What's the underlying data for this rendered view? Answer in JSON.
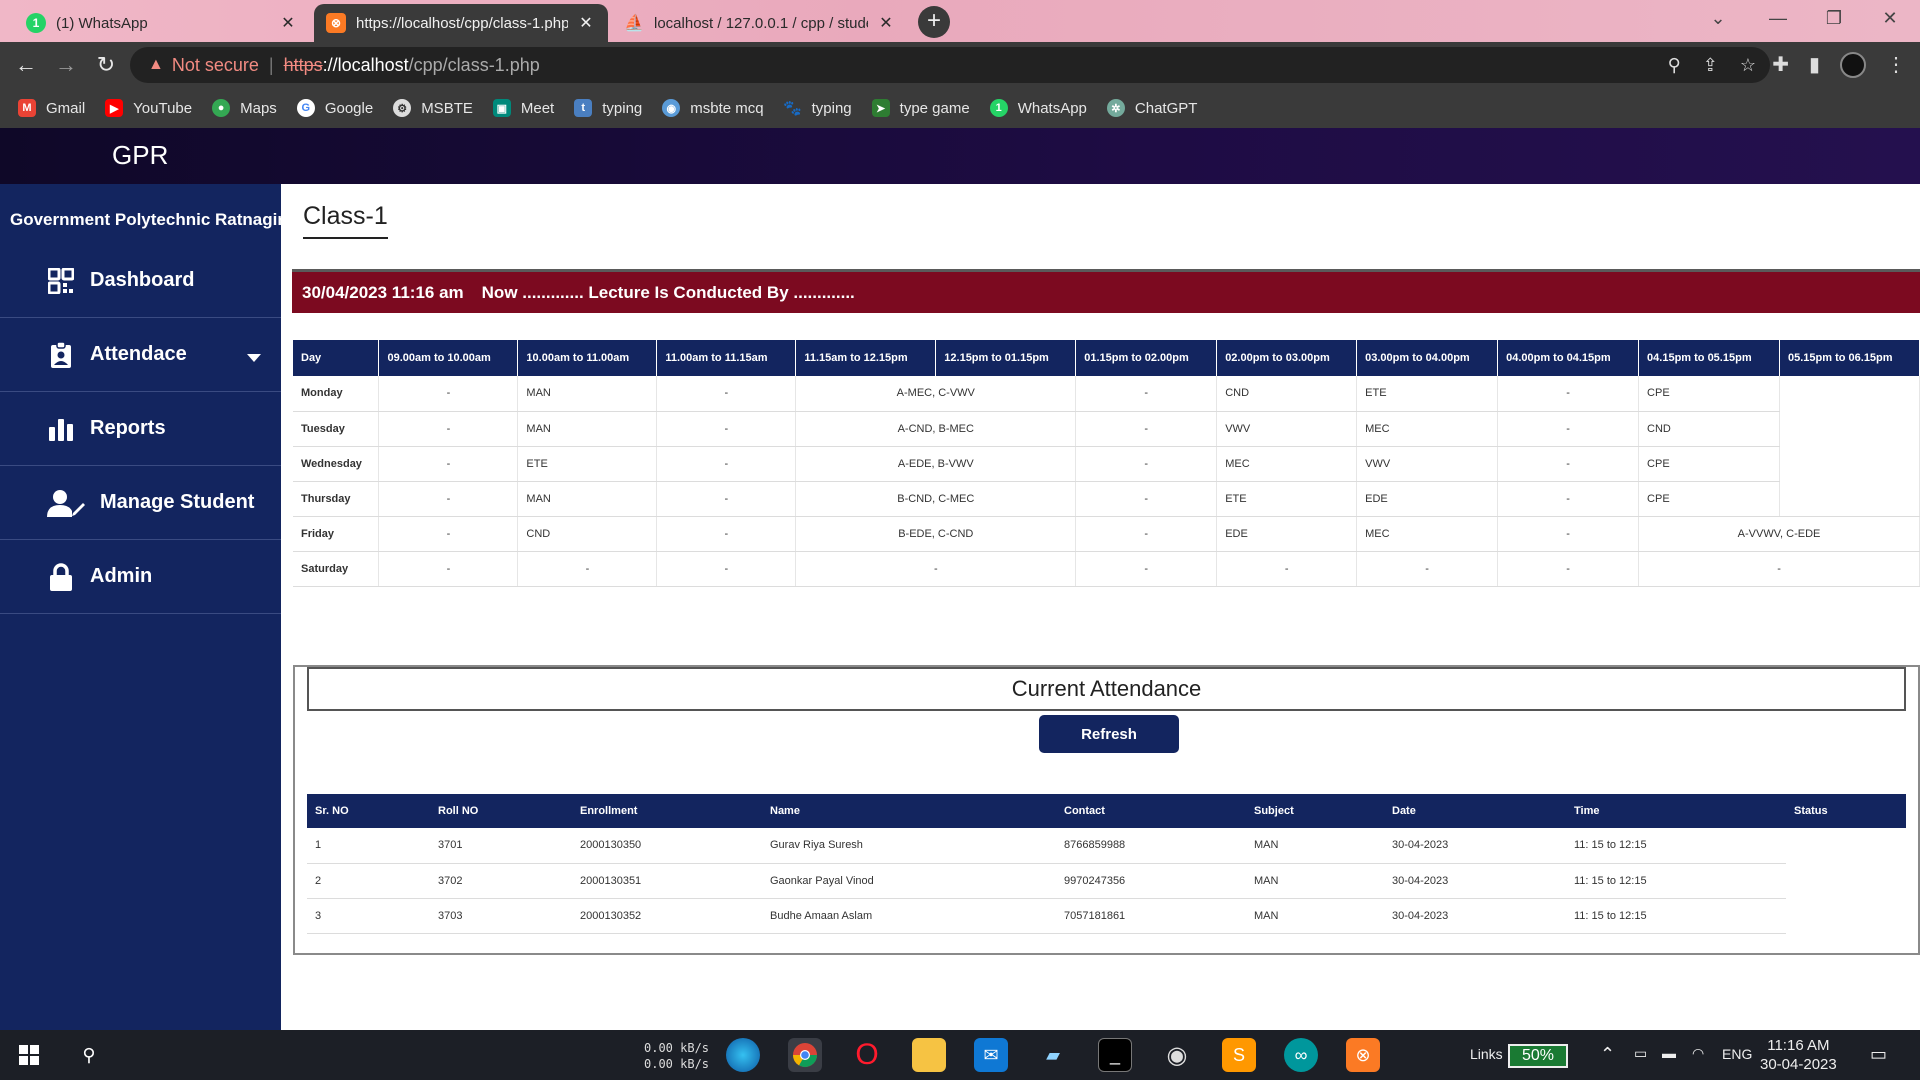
{
  "browser": {
    "tabs": [
      {
        "title": "(1) WhatsApp",
        "close": "✕"
      },
      {
        "title": "https://localhost/cpp/class-1.php",
        "close": "✕"
      },
      {
        "title": "localhost / 127.0.0.1 / cpp / stude",
        "close": "✕"
      }
    ],
    "new_tab": "+",
    "not_secure": "Not secure",
    "url_scheme": "https",
    "url_host": "://localhost",
    "url_path": "/cpp/class-1.php",
    "bookmarks": [
      "Gmail",
      "YouTube",
      "Maps",
      "Google",
      "MSBTE",
      "Meet",
      "typing",
      "msbte mcq",
      "typing",
      "type game",
      "WhatsApp",
      "ChatGPT"
    ]
  },
  "app": {
    "brand": "GPR",
    "college": "Government Polytechnic Ratnagiri",
    "nav": [
      {
        "label": "Dashboard"
      },
      {
        "label": "Attendace"
      },
      {
        "label": "Reports"
      },
      {
        "label": "Manage Student"
      },
      {
        "label": "Admin"
      }
    ]
  },
  "main": {
    "class_title": "Class-1",
    "banner_datetime": "30/04/2023 11:16 am",
    "banner_text": "Now ............. Lecture Is Conducted By .............",
    "timetable": {
      "headers": [
        "Day",
        "09.00am to 10.00am",
        "10.00am to 11.00am",
        "11.00am to 11.15am",
        "11.15am to 12.15pm",
        "12.15pm to 01.15pm",
        "01.15pm to 02.00pm",
        "02.00pm to 03.00pm",
        "03.00pm to 04.00pm",
        "04.00pm to 04.15pm",
        "04.15pm to 05.15pm",
        "05.15pm to 06.15pm"
      ],
      "rows": [
        {
          "day": "Monday",
          "c9": "-",
          "c10": "MAN",
          "cb1": "-",
          "c11": "A-MEC, C-VWV",
          "cl": "-",
          "c2": "CND",
          "c3": "ETE",
          "cb2": "-",
          "c4": "CPE"
        },
        {
          "day": "Tuesday",
          "c9": "-",
          "c10": "MAN",
          "cb1": "-",
          "c11": "A-CND, B-MEC",
          "cl": "-",
          "c2": "VWV",
          "c3": "MEC",
          "cb2": "-",
          "c4": "CND"
        },
        {
          "day": "Wednesday",
          "c9": "-",
          "c10": "ETE",
          "cb1": "-",
          "c11": "A-EDE, B-VWV",
          "cl": "-",
          "c2": "MEC",
          "c3": "VWV",
          "cb2": "-",
          "c4": "CPE"
        },
        {
          "day": "Thursday",
          "c9": "-",
          "c10": "MAN",
          "cb1": "-",
          "c11": "B-CND, C-MEC",
          "cl": "-",
          "c2": "ETE",
          "c3": "EDE",
          "cb2": "-",
          "c4": "CPE"
        },
        {
          "day": "Friday",
          "c9": "-",
          "c10": "CND",
          "cb1": "-",
          "c11": "B-EDE, C-CND",
          "cl": "-",
          "c2": "EDE",
          "c3": "MEC",
          "cb2": "-",
          "c4": "A-VVWV, C-EDE"
        },
        {
          "day": "Saturday",
          "c9": "-",
          "c10": "-",
          "cb1": "-",
          "c11": "-",
          "cl": "-",
          "c2": "-",
          "c3": "-",
          "cb2": "-",
          "c4": "-"
        }
      ]
    },
    "attendance": {
      "title": "Current Attendance",
      "refresh_label": "Refresh",
      "headers": [
        "Sr. NO",
        "Roll NO",
        "Enrollment",
        "Name",
        "Contact",
        "Subject",
        "Date",
        "Time",
        "Status"
      ],
      "rows": [
        {
          "sr": "1",
          "roll": "3701",
          "enroll": "2000130350",
          "name": "Gurav Riya Suresh",
          "contact": "8766859988",
          "subject": "MAN",
          "date": "30-04-2023",
          "time": "11: 15 to 12:15"
        },
        {
          "sr": "2",
          "roll": "3702",
          "enroll": "2000130351",
          "name": "Gaonkar Payal Vinod",
          "contact": "9970247356",
          "subject": "MAN",
          "date": "30-04-2023",
          "time": "11: 15 to 12:15"
        },
        {
          "sr": "3",
          "roll": "3703",
          "enroll": "2000130352",
          "name": "Budhe Amaan Aslam",
          "contact": "7057181861",
          "subject": "MAN",
          "date": "30-04-2023",
          "time": "11: 15 to 12:15"
        }
      ]
    }
  },
  "taskbar": {
    "net_up": "0.00 kB/s",
    "net_down": "0.00 kB/s",
    "links_label": "Links",
    "battery": "50%",
    "lang": "ENG",
    "time": "11:16 AM",
    "date": "30-04-2023"
  },
  "colors": {
    "primary": "#13255f",
    "banner": "#7c0a20",
    "topbar": "#1e0c44"
  }
}
